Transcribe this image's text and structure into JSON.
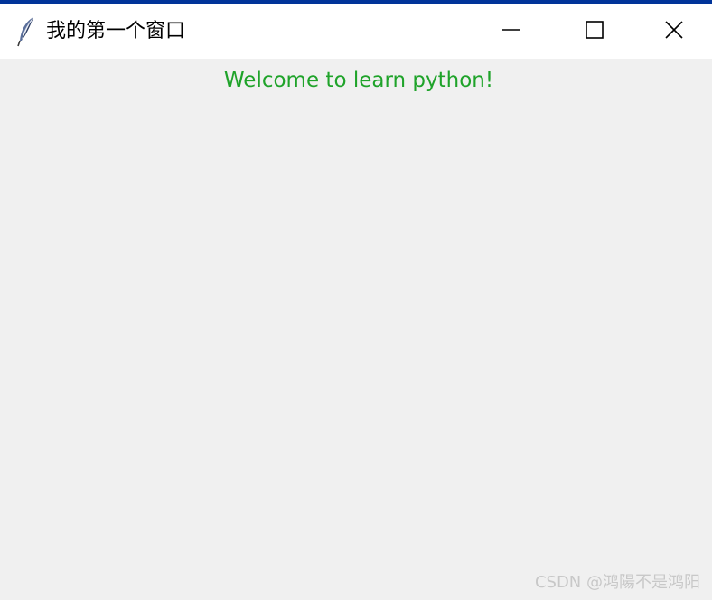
{
  "window": {
    "title": "我的第一个窗口",
    "icon": "feather-icon",
    "controls": {
      "minimize_icon": "minimize-icon",
      "maximize_icon": "maximize-icon",
      "close_icon": "close-icon"
    }
  },
  "content": {
    "label_text": "Welcome to learn python!"
  },
  "watermark": {
    "text": "CSDN @鸿陽不是鸿阳"
  },
  "colors": {
    "accent_bar": "#003399",
    "label_text": "#1fa32a",
    "titlebar_bg": "#ffffff",
    "client_bg": "#f0f0f0",
    "watermark": "#c8c8c8"
  }
}
